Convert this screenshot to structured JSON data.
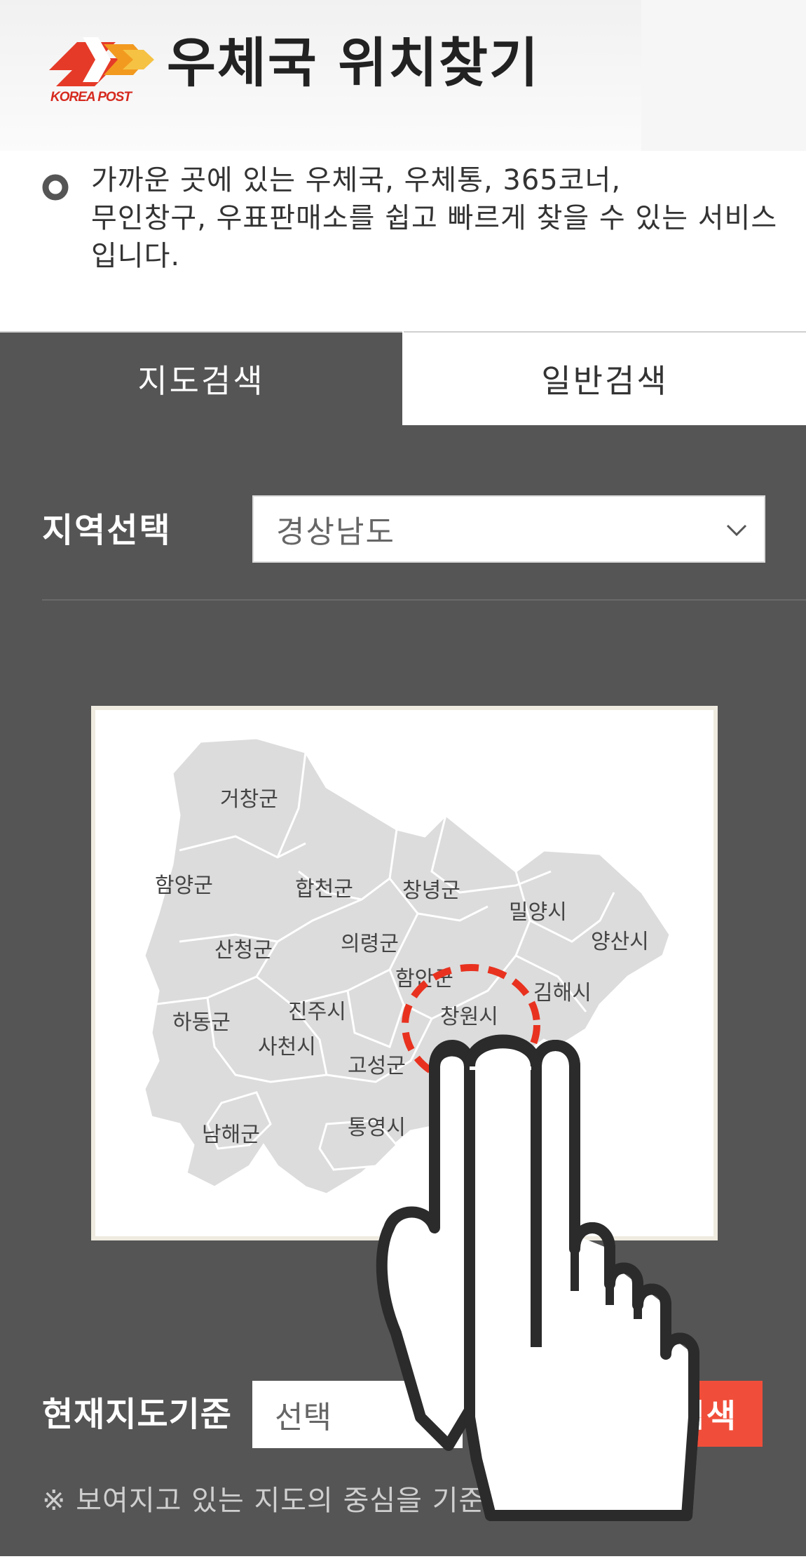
{
  "header": {
    "logo_text": "KOREA POST",
    "title": "우체국 위치찾기"
  },
  "intro": {
    "text": "가까운 곳에 있는 우체국, 우체통, 365코너,\n무인창구, 우표판매소를 쉽고 빠르게 찾을 수 있는 서비스\n입니다."
  },
  "tabs": {
    "map_search": "지도검색",
    "general_search": "일반검색"
  },
  "region": {
    "label": "지역선택",
    "selected": "경상남도"
  },
  "map": {
    "labels": [
      "거창군",
      "함양군",
      "합천군",
      "창녕군",
      "밀양시",
      "양산시",
      "산청군",
      "의령군",
      "함안군",
      "김해시",
      "하동군",
      "진주시",
      "창원시",
      "사천시",
      "고성군",
      "남해군",
      "통영시"
    ]
  },
  "current_map": {
    "label": "현재지도기준",
    "select_value": "선택",
    "search_button": "검색"
  },
  "note": "※ 보여지고 있는 지도의 중심을 기준으로 검색합니다.",
  "colors": {
    "accent_red": "#f04e3a",
    "panel_gray": "#555555",
    "map_region": "#dcdcdc"
  }
}
